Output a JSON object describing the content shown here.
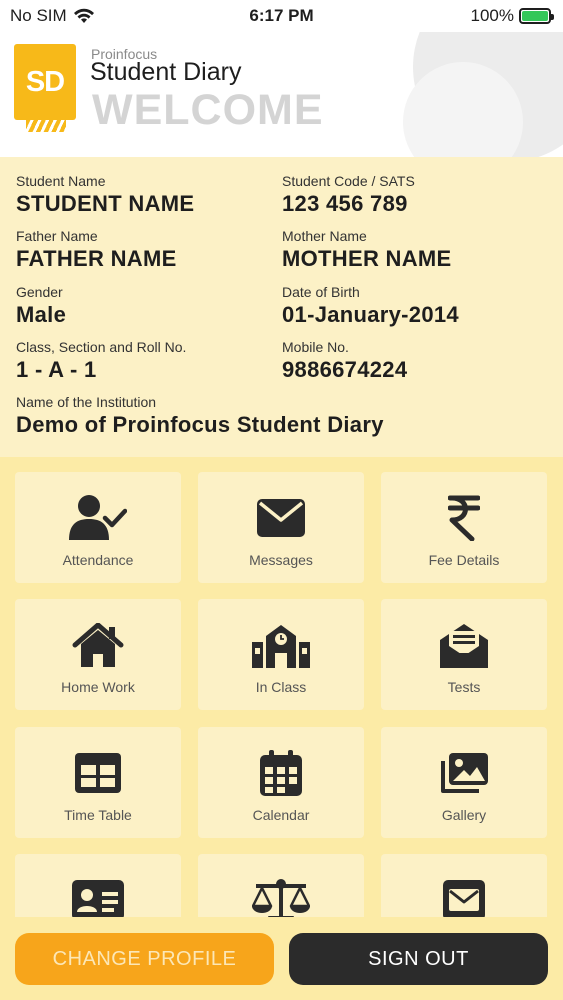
{
  "status_bar": {
    "carrier": "No SIM",
    "time": "6:17 PM",
    "battery": "100%"
  },
  "header": {
    "logo_text": "SD",
    "brand_small": "Proinfocus",
    "brand_title": "Student Diary",
    "welcome": "WELCOME"
  },
  "profile": {
    "student_name_label": "Student Name",
    "student_name": "STUDENT NAME",
    "student_code_label": "Student Code / SATS",
    "student_code": "123 456 789",
    "father_label": "Father Name",
    "father_name": "FATHER NAME",
    "mother_label": "Mother Name",
    "mother_name": "MOTHER NAME",
    "gender_label": "Gender",
    "gender": "Male",
    "dob_label": "Date of Birth",
    "dob": "01-January-2014",
    "class_label": "Class, Section and Roll No.",
    "class_value": "1 - A - 1",
    "mobile_label": "Mobile No.",
    "mobile": "9886674224",
    "institution_label": "Name of the Institution",
    "institution": "Demo of Proinfocus Student Diary"
  },
  "menu": {
    "attendance": "Attendance",
    "messages": "Messages",
    "fee_details": "Fee Details",
    "home_work": "Home Work",
    "in_class": "In Class",
    "tests": "Tests",
    "time_table": "Time Table",
    "calendar": "Calendar",
    "gallery": "Gallery"
  },
  "buttons": {
    "change_profile": "CHANGE PROFILE",
    "sign_out": "SIGN OUT"
  },
  "colors": {
    "accent": "#F7B919",
    "background": "#FCEBA6",
    "tile": "#FCF1C6",
    "dark": "#2b2b2b"
  }
}
